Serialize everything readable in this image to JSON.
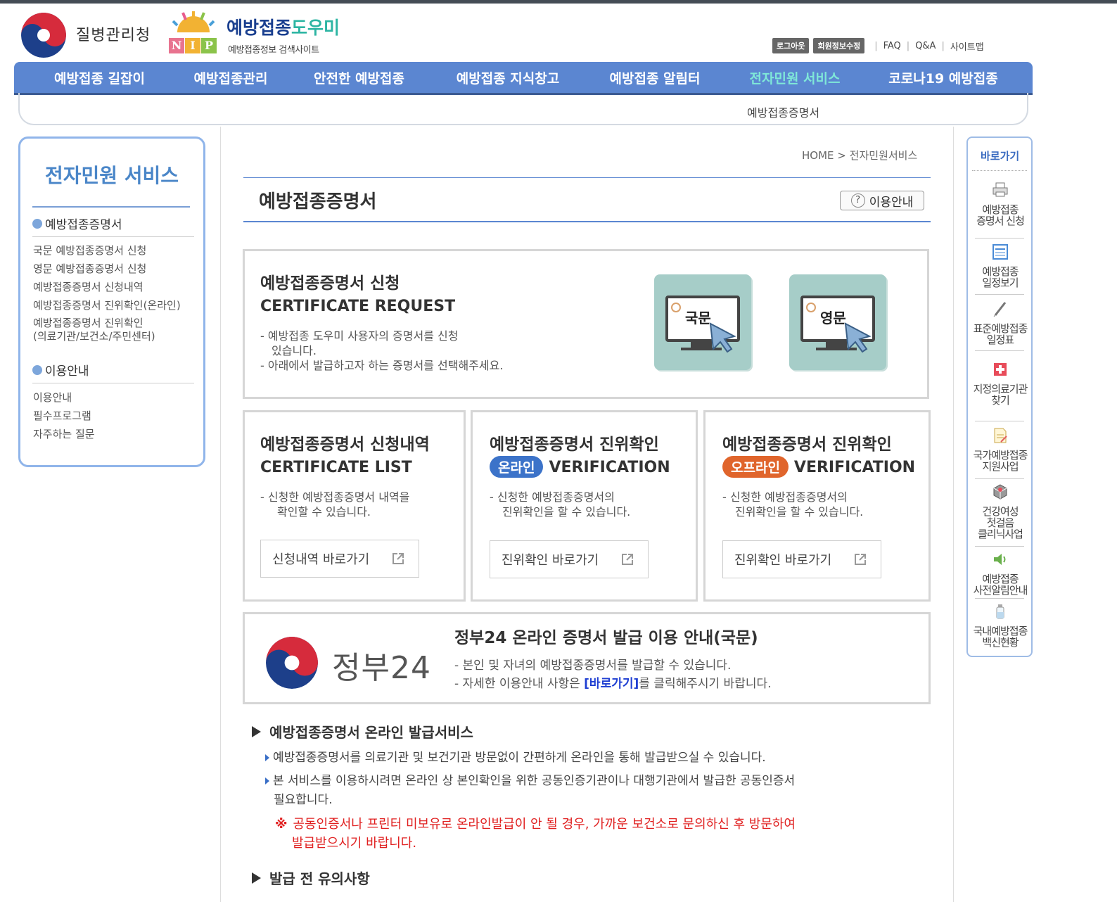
{
  "header": {
    "agency_name": "질병관리청",
    "site_title_main": "예방접종",
    "site_title_accent": "도우미",
    "site_subtitle": "예방접종정보 검색사이트",
    "nip_letters": [
      "N",
      "I",
      "P"
    ],
    "utility": {
      "logout": "로그아웃",
      "edit_profile": "회원정보수정",
      "faq": "FAQ",
      "qna": "Q&A",
      "sitemap": "사이트맵"
    }
  },
  "nav": {
    "items": [
      "예방접종 길잡이",
      "예방접종관리",
      "안전한 예방접종",
      "예방접종 지식창고",
      "예방접종 알림터",
      "전자민원 서비스",
      "코로나19 예방접종"
    ],
    "active_index": 5,
    "sub_item": "예방접종증명서"
  },
  "left_sidebar": {
    "title": "전자민원 서비스",
    "sections": [
      {
        "heading": "예방접종증명서",
        "links": [
          "국문 예방접종증명서 신청",
          "영문 예방접종증명서 신청",
          "예방접종증명서 신청내역",
          "예방접종증명서 진위확인(온라인)",
          "예방접종증명서 진위확인",
          "(의료기관/보건소/주민센터)"
        ]
      },
      {
        "heading": "이용안내",
        "links": [
          "이용안내",
          "필수프로그램",
          "자주하는 질문"
        ]
      }
    ]
  },
  "breadcrumb": {
    "home": "HOME",
    "separator": ">",
    "current": "전자민원서비스"
  },
  "page": {
    "title": "예방접종증명서",
    "guide_button": "이용안내",
    "guide_icon_glyph": "?"
  },
  "request_box": {
    "title_kor": "예방접종증명서 신청",
    "title_eng": "CERTIFICATE REQUEST",
    "desc_1a": "- 예방접종 도우미 사용자의 증명서를 신청",
    "desc_1b": "있습니다.",
    "desc_2": "- 아래에서 발급하고자 하는 증명서를 선택해주세요.",
    "card_korean": "국문",
    "card_english": "영문"
  },
  "list_box": {
    "title_kor": "예방접종증명서 신청내역",
    "title_eng": "CERTIFICATE LIST",
    "desc_a": "- 신청한 예방접종증명서 내역을",
    "desc_b": "확인할 수 있습니다.",
    "button": "신청내역 바로가기"
  },
  "online_box": {
    "title_kor": "예방접종증명서 진위확인",
    "badge": "온라인",
    "title_eng": "VERIFICATION",
    "desc_a": "- 신청한 예방접종증명서의",
    "desc_b": "진위확인을 할 수 있습니다.",
    "button": "진위확인 바로가기"
  },
  "offline_box": {
    "title_kor": "예방접종증명서 진위확인",
    "badge": "오프라인",
    "title_eng": "VERIFICATION",
    "desc_a": "- 신청한 예방접종증명서의",
    "desc_b": "진위확인을 할 수 있습니다.",
    "button": "진위확인 바로가기"
  },
  "gov24_box": {
    "logo_text": "정부24",
    "title": "정부24 온라인 증명서 발급 이용 안내(국문)",
    "desc_1": "- 본인 및 자녀의 예방접종증명서를 발급할 수 있습니다.",
    "desc_2_pre": "- 자세한 이용안내 사항은 ",
    "desc_2_link": "[바로가기]",
    "desc_2_post": "를 클릭해주시기 바랍니다."
  },
  "online_service": {
    "heading": "예방접종증명서 온라인 발급서비스",
    "item_1": "예방접종증명서를 의료기관 및 보건기관 방문없이 간편하게 온라인을 통해 발급받으실 수 있습니다.",
    "item_2a": "본 서비스를 이용하시려면 온라인 상 본인확인을 위한 공동인증기관이나 대행기관에서 발급한 공동인증서",
    "item_2b": "필요합니다.",
    "warning_mark": "※",
    "warning_a": "공동인증서나 프린터 미보유로 온라인발급이 안 될 경우, 가까운 보건소로 문의하신 후 방문하여",
    "warning_b": "발급받으시기 바랍니다."
  },
  "notice": {
    "heading": "발급 전 유의사항"
  },
  "right_sidebar": {
    "title": "바로가기",
    "items": [
      {
        "line1": "예방접종",
        "line2": "증명서 신청",
        "line3": "",
        "icon": "printer-icon"
      },
      {
        "line1": "예방접종",
        "line2": "일정보기",
        "line3": "",
        "icon": "schedule-icon"
      },
      {
        "line1": "표준예방접종",
        "line2": "일정표",
        "line3": "",
        "icon": "syringe-icon"
      },
      {
        "line1": "지정의료기관",
        "line2": "찾기",
        "line3": "",
        "icon": "hospital-icon"
      },
      {
        "line1": "국가예방접종",
        "line2": "지원사업",
        "line3": "",
        "icon": "document-icon"
      },
      {
        "line1": "건강여성",
        "line2": "첫걸음",
        "line3": "클리닉사업",
        "icon": "gift-icon"
      },
      {
        "line1": "예방접종",
        "line2": "사전알림안내",
        "line3": "",
        "icon": "speaker-icon"
      },
      {
        "line1": "국내예방접종",
        "line2": "백신현황",
        "line3": "",
        "icon": "vaccine-vial-icon"
      }
    ]
  },
  "colors": {
    "nav_bg": "#5b86d1",
    "nav_active": "#7fe8d8",
    "online_badge": "#3c73c9",
    "offline_badge": "#e0652c",
    "warning": "#e02020",
    "link": "#1f3fd2",
    "card_bg": "#a6cdc8"
  }
}
